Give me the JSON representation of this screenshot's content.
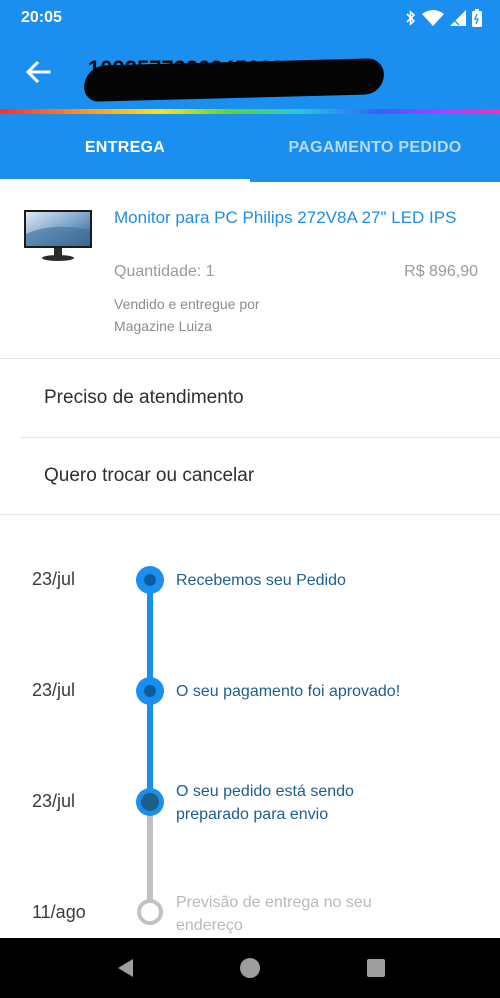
{
  "status_bar": {
    "time": "20:05",
    "icons": [
      "bluetooth-icon",
      "wifi-icon",
      "signal-icon",
      "battery-icon"
    ]
  },
  "app_bar": {
    "back_icon": "arrow-left-icon",
    "order_number": "1093577330245669"
  },
  "tabs": [
    {
      "label": "ENTREGA",
      "active": true
    },
    {
      "label": "PAGAMENTO PEDIDO",
      "active": false
    }
  ],
  "product": {
    "name": "Monitor para PC Philips 272V8A 27\" LED IPS",
    "quantity": "Quantidade: 1",
    "price": "R$ 896,90",
    "seller_line1": "Vendido e entregue por",
    "seller_line2": "Magazine Luiza"
  },
  "menu": {
    "support": "Preciso de atendimento",
    "exchange": "Quero trocar ou cancelar"
  },
  "timeline": [
    {
      "date": "23/jul",
      "text": "Recebemos seu Pedido",
      "done": true
    },
    {
      "date": "23/jul",
      "text": "O seu pagamento foi aprovado!",
      "done": true
    },
    {
      "date": "23/jul",
      "text_line1": "O seu pedido está sendo",
      "text_line2": "preparado para envio",
      "done": true,
      "current": true
    },
    {
      "date": "11/ago",
      "text_line1": "Previsão de entrega no seu",
      "text_line2": "endereço",
      "done": false
    }
  ],
  "colors": {
    "brand_blue": "#1a8ff0",
    "link_blue": "#1f8de6",
    "timeline_text": "#1b5f8f",
    "pending_gray": "#c2c2c2"
  },
  "nav_bar": {
    "icons": [
      "back-triangle-icon",
      "home-circle-icon",
      "recents-square-icon"
    ]
  }
}
